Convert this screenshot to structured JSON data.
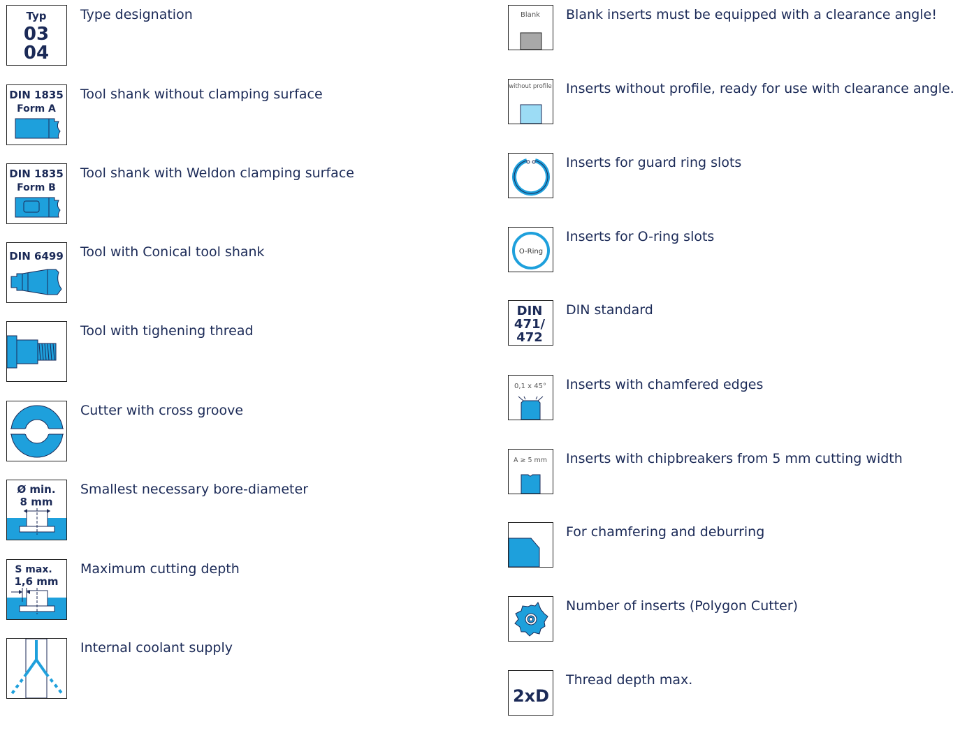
{
  "colors": {
    "accent": "#1ea0dc",
    "text": "#1b2a57",
    "gray": "#a8a8a8",
    "light_blue": "#9cdcf5"
  },
  "left": [
    {
      "icon": "type-designation-icon",
      "icon_text": [
        "Typ",
        "03",
        "04"
      ],
      "label": "Type designation"
    },
    {
      "icon": "din-1835-form-a-icon",
      "icon_text": [
        "DIN 1835",
        "Form A"
      ],
      "label": "Tool shank without clamping surface"
    },
    {
      "icon": "din-1835-form-b-icon",
      "icon_text": [
        "DIN 1835",
        "Form B"
      ],
      "label": "Tool shank with Weldon clamping surface"
    },
    {
      "icon": "din-6499-icon",
      "icon_text": [
        "DIN 6499"
      ],
      "label": "Tool with Conical tool shank"
    },
    {
      "icon": "thread-shank-icon",
      "icon_text": [],
      "label": "Tool with tighening thread"
    },
    {
      "icon": "cross-groove-icon",
      "icon_text": [],
      "label": "Cutter with cross groove"
    },
    {
      "icon": "bore-diameter-icon",
      "icon_text": [
        "Ø min.",
        "8 mm"
      ],
      "label": "Smallest necessary bore-diameter"
    },
    {
      "icon": "cutting-depth-icon",
      "icon_text": [
        "S max.",
        "1,6 mm"
      ],
      "label": "Maximum cutting depth"
    },
    {
      "icon": "coolant-icon",
      "icon_text": [],
      "label": "Internal coolant supply"
    }
  ],
  "right": [
    {
      "icon": "blank-insert-icon",
      "icon_text": [
        "Blank"
      ],
      "label": "Blank inserts must be equipped with a clearance angle!"
    },
    {
      "icon": "without-profile-icon",
      "icon_text": [
        "without profile"
      ],
      "label": "Inserts without profile, ready for use with clearance angle."
    },
    {
      "icon": "guard-ring-icon",
      "icon_text": [],
      "label": "Inserts for guard ring slots"
    },
    {
      "icon": "o-ring-icon",
      "icon_text": [
        "O-Ring"
      ],
      "label": "Inserts for O-ring slots"
    },
    {
      "icon": "din-471-472-icon",
      "icon_text": [
        "DIN",
        "471/",
        "472"
      ],
      "label": "DIN standard"
    },
    {
      "icon": "chamfered-edges-icon",
      "icon_text": [
        "0,1 x 45°"
      ],
      "label": "Inserts with chamfered edges"
    },
    {
      "icon": "chipbreaker-icon",
      "icon_text": [
        "A ≥ 5 mm"
      ],
      "label": "Inserts with chipbreakers from 5 mm cutting width"
    },
    {
      "icon": "chamfer-deburr-icon",
      "icon_text": [],
      "label": "For chamfering and deburring"
    },
    {
      "icon": "polygon-cutter-icon",
      "icon_text": [],
      "label": "Number of inserts (Polygon Cutter)"
    },
    {
      "icon": "thread-depth-icon",
      "icon_text": [
        "2xD"
      ],
      "label": "Thread depth max."
    }
  ]
}
